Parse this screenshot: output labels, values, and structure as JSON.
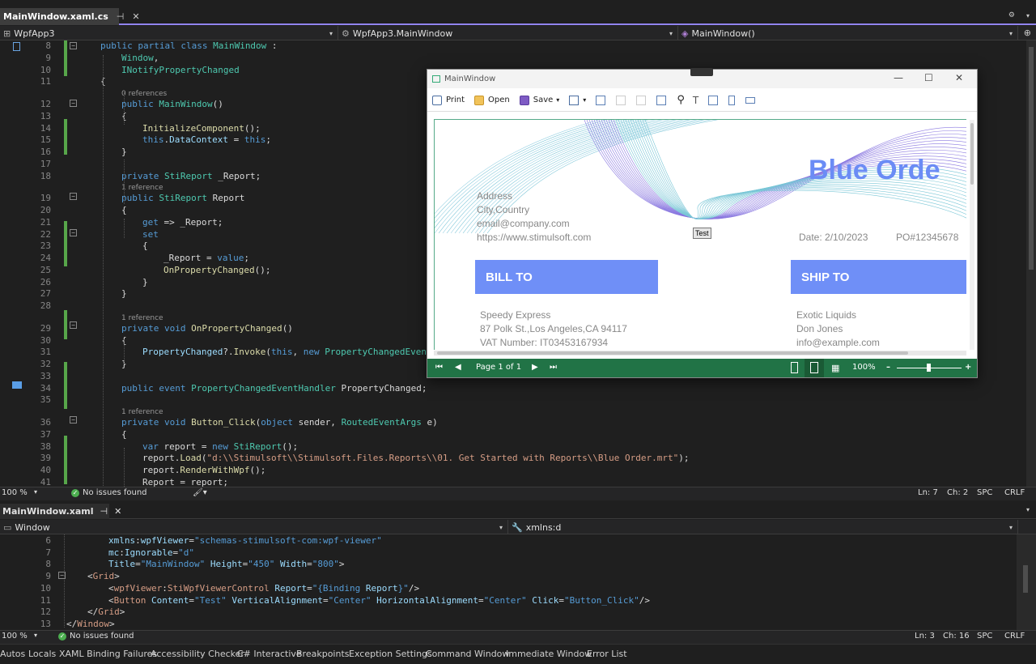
{
  "cs_tab": {
    "title": "MainWindow.xaml.cs",
    "pin": "⊣",
    "close": "✕"
  },
  "cs_nav": {
    "project": "WpfApp3",
    "class": "WpfApp3.MainWindow",
    "member": "MainWindow()"
  },
  "cs_status": {
    "zoom": "100 %",
    "issues": "No issues found",
    "ln": "Ln: 7",
    "ch": "Ch: 2",
    "spc": "SPC",
    "crlf": "CRLF"
  },
  "cs_lines": [
    {
      "n": "8",
      "t": [
        [
          "kw",
          "public partial class "
        ],
        [
          "ty",
          "MainWindow"
        ],
        [
          "id",
          " :"
        ]
      ],
      "ind": 0
    },
    {
      "n": "9",
      "t": [
        [
          "ty",
          "Window"
        ],
        [
          "id",
          ","
        ]
      ],
      "ind": 1
    },
    {
      "n": "10",
      "t": [
        [
          "ty",
          "INotifyPropertyChanged"
        ]
      ],
      "ind": 1
    },
    {
      "n": "11",
      "t": [
        [
          "id",
          "{"
        ]
      ],
      "ind": 0
    },
    {
      "ref": "0 references"
    },
    {
      "n": "12",
      "t": [
        [
          "kw",
          "public "
        ],
        [
          "ty",
          "MainWindow"
        ],
        [
          "id",
          "()"
        ]
      ],
      "ind": 1
    },
    {
      "n": "13",
      "t": [
        [
          "id",
          "{"
        ]
      ],
      "ind": 1
    },
    {
      "n": "14",
      "t": [
        [
          "fn",
          "InitializeComponent"
        ],
        [
          "id",
          "();"
        ]
      ],
      "ind": 2
    },
    {
      "n": "15",
      "t": [
        [
          "kw",
          "this"
        ],
        [
          "id",
          "."
        ],
        [
          "pr",
          "DataContext"
        ],
        [
          "id",
          " = "
        ],
        [
          "kw",
          "this"
        ],
        [
          "id",
          ";"
        ]
      ],
      "ind": 2
    },
    {
      "n": "16",
      "t": [
        [
          "id",
          "}"
        ]
      ],
      "ind": 1
    },
    {
      "n": "17",
      "t": [],
      "ind": 0
    },
    {
      "n": "18",
      "t": [
        [
          "kw",
          "private "
        ],
        [
          "ty",
          "StiReport"
        ],
        [
          "id",
          " _Report;"
        ]
      ],
      "ind": 1
    },
    {
      "ref": "1 reference"
    },
    {
      "n": "19",
      "t": [
        [
          "kw",
          "public "
        ],
        [
          "ty",
          "StiReport"
        ],
        [
          "id",
          " Report"
        ]
      ],
      "ind": 1
    },
    {
      "n": "20",
      "t": [
        [
          "id",
          "{"
        ]
      ],
      "ind": 1
    },
    {
      "n": "21",
      "t": [
        [
          "kw",
          "get"
        ],
        [
          "id",
          " => _Report;"
        ]
      ],
      "ind": 2
    },
    {
      "n": "22",
      "t": [
        [
          "kw",
          "set"
        ]
      ],
      "ind": 2
    },
    {
      "n": "23",
      "t": [
        [
          "id",
          "{"
        ]
      ],
      "ind": 2
    },
    {
      "n": "24",
      "t": [
        [
          "id",
          "_Report = "
        ],
        [
          "kw",
          "value"
        ],
        [
          "id",
          ";"
        ]
      ],
      "ind": 3
    },
    {
      "n": "25",
      "t": [
        [
          "fn",
          "OnPropertyChanged"
        ],
        [
          "id",
          "();"
        ]
      ],
      "ind": 3
    },
    {
      "n": "26",
      "t": [
        [
          "id",
          "}"
        ]
      ],
      "ind": 2
    },
    {
      "n": "27",
      "t": [
        [
          "id",
          "}"
        ]
      ],
      "ind": 1
    },
    {
      "n": "28",
      "t": [],
      "ind": 0
    },
    {
      "ref": "1 reference"
    },
    {
      "n": "29",
      "t": [
        [
          "kw",
          "private void "
        ],
        [
          "fn",
          "OnPropertyChanged"
        ],
        [
          "id",
          "()"
        ]
      ],
      "ind": 1
    },
    {
      "n": "30",
      "t": [
        [
          "id",
          "{"
        ]
      ],
      "ind": 1
    },
    {
      "n": "31",
      "t": [
        [
          "pr",
          "PropertyChanged"
        ],
        [
          "id",
          "?."
        ],
        [
          "fn",
          "Invoke"
        ],
        [
          "id",
          "("
        ],
        [
          "kw",
          "this"
        ],
        [
          "id",
          ", "
        ],
        [
          "kw",
          "new "
        ],
        [
          "ty",
          "PropertyChangedEvent"
        ]
      ],
      "ind": 2
    },
    {
      "n": "32",
      "t": [
        [
          "id",
          "}"
        ]
      ],
      "ind": 1
    },
    {
      "n": "33",
      "t": [],
      "ind": 0
    },
    {
      "n": "34",
      "t": [
        [
          "kw",
          "public event "
        ],
        [
          "ty",
          "PropertyChangedEventHandler"
        ],
        [
          "id",
          " PropertyChanged;"
        ]
      ],
      "ind": 1
    },
    {
      "n": "35",
      "t": [],
      "ind": 0
    },
    {
      "ref": "1 reference"
    },
    {
      "n": "36",
      "t": [
        [
          "kw",
          "private void "
        ],
        [
          "fn",
          "Button_Click"
        ],
        [
          "id",
          "("
        ],
        [
          "kw",
          "object"
        ],
        [
          "id",
          " sender, "
        ],
        [
          "ty",
          "RoutedEventArgs"
        ],
        [
          "id",
          " e)"
        ]
      ],
      "ind": 1
    },
    {
      "n": "37",
      "t": [
        [
          "id",
          "{"
        ]
      ],
      "ind": 1
    },
    {
      "n": "38",
      "t": [
        [
          "kw",
          "var"
        ],
        [
          "id",
          " report = "
        ],
        [
          "kw",
          "new "
        ],
        [
          "ty",
          "StiReport"
        ],
        [
          "id",
          "();"
        ]
      ],
      "ind": 2
    },
    {
      "n": "39",
      "t": [
        [
          "id",
          "report."
        ],
        [
          "fn",
          "Load"
        ],
        [
          "id",
          "("
        ],
        [
          "st",
          "\"d:\\\\Stimulsoft\\\\Stimulsoft.Files.Reports\\\\01. Get Started with Reports\\\\Blue Order.mrt\""
        ],
        [
          "id",
          ");"
        ]
      ],
      "ind": 2
    },
    {
      "n": "40",
      "t": [
        [
          "id",
          "report."
        ],
        [
          "fn",
          "RenderWithWpf"
        ],
        [
          "id",
          "();"
        ]
      ],
      "ind": 2
    },
    {
      "n": "41",
      "t": [
        [
          "id",
          "Report = report;"
        ]
      ],
      "ind": 2
    }
  ],
  "xaml_tab": {
    "title": "MainWindow.xaml",
    "pin": "⊣",
    "close": "✕"
  },
  "xaml_nav": {
    "left": "Window",
    "right": "xmlns:d"
  },
  "xaml_status": {
    "zoom": "100 %",
    "issues": "No issues found",
    "ln": "Ln: 3",
    "ch": "Ch: 16",
    "spc": "SPC",
    "crlf": "CRLF"
  },
  "xaml_lines": [
    {
      "n": "6",
      "t": [
        [
          "pr",
          "xmlns"
        ],
        [
          "id",
          ":"
        ],
        [
          "pr",
          "wpfViewer"
        ],
        [
          "id",
          "="
        ],
        [
          "kw",
          "\"schemas-stimulsoft-com:wpf-viewer\""
        ]
      ],
      "ind": 2
    },
    {
      "n": "7",
      "t": [
        [
          "pr",
          "mc"
        ],
        [
          "id",
          ":"
        ],
        [
          "pr",
          "Ignorable"
        ],
        [
          "id",
          "="
        ],
        [
          "kw",
          "\"d\""
        ]
      ],
      "ind": 2
    },
    {
      "n": "8",
      "t": [
        [
          "pr",
          "Title"
        ],
        [
          "id",
          "="
        ],
        [
          "kw",
          "\"MainWindow\""
        ],
        [
          "pr",
          " Height"
        ],
        [
          "id",
          "="
        ],
        [
          "kw",
          "\"450\""
        ],
        [
          "pr",
          " Width"
        ],
        [
          "id",
          "="
        ],
        [
          "kw",
          "\"800\""
        ],
        [
          "id",
          ">"
        ]
      ],
      "ind": 2
    },
    {
      "n": "9",
      "t": [
        [
          "id",
          "<"
        ],
        [
          "st",
          "Grid"
        ],
        [
          "id",
          ">"
        ]
      ],
      "ind": 1
    },
    {
      "n": "10",
      "t": [
        [
          "id",
          "<"
        ],
        [
          "st",
          "wpfViewer"
        ],
        [
          "id",
          ":"
        ],
        [
          "st",
          "StiWpfViewerControl"
        ],
        [
          "pr",
          " Report"
        ],
        [
          "id",
          "="
        ],
        [
          "kw",
          "\"{Binding "
        ],
        [
          "pr",
          "Report"
        ],
        [
          "kw",
          "}\""
        ],
        [
          "id",
          "/>"
        ]
      ],
      "ind": 2
    },
    {
      "n": "11",
      "t": [
        [
          "id",
          "<"
        ],
        [
          "st",
          "Button"
        ],
        [
          "pr",
          " Content"
        ],
        [
          "id",
          "="
        ],
        [
          "kw",
          "\"Test\""
        ],
        [
          "pr",
          " VerticalAlignment"
        ],
        [
          "id",
          "="
        ],
        [
          "kw",
          "\"Center\""
        ],
        [
          "pr",
          " HorizontalAlignment"
        ],
        [
          "id",
          "="
        ],
        [
          "kw",
          "\"Center\""
        ],
        [
          "pr",
          " Click"
        ],
        [
          "id",
          "="
        ],
        [
          "kw",
          "\"Button_Click\""
        ],
        [
          "id",
          "/>"
        ]
      ],
      "ind": 2
    },
    {
      "n": "12",
      "t": [
        [
          "id",
          "</"
        ],
        [
          "st",
          "Grid"
        ],
        [
          "id",
          ">"
        ]
      ],
      "ind": 1
    },
    {
      "n": "13",
      "t": [
        [
          "id",
          "</"
        ],
        [
          "st",
          "Window"
        ],
        [
          "id",
          ">"
        ]
      ],
      "ind": 0
    }
  ],
  "wpf": {
    "title": "MainWindow",
    "toolbar": {
      "print": "Print",
      "open": "Open",
      "save": "Save"
    },
    "report": {
      "title": "Blue Orde",
      "address": [
        "Address",
        "City,Country",
        "email@company.com",
        "https://www.stimulsoft.com"
      ],
      "date": "Date: 2/10/2023",
      "po": "PO#12345678",
      "bill_to": "BILL TO",
      "ship_to": "SHIP TO",
      "bill": [
        "Speedy Express",
        "87 Polk St.,Los Angeles,CA 94117",
        "VAT Number: IT03453167934"
      ],
      "ship": [
        "Exotic Liquids",
        "Don Jones",
        "info@example.com"
      ]
    },
    "test_button": "Test",
    "viewer": {
      "page": "Page 1 of 1",
      "zoom": "100%"
    },
    "accent": "#217346",
    "band_color": "#6f8ff7",
    "title_color": "#6b8cf5"
  },
  "bottom_tabs": [
    "Autos",
    "Locals",
    "XAML Binding Failures",
    "Accessibility Checker",
    "C# Interactive",
    "Breakpoints",
    "Exception Settings",
    "Command Window",
    "Immediate Window",
    "Error List"
  ]
}
